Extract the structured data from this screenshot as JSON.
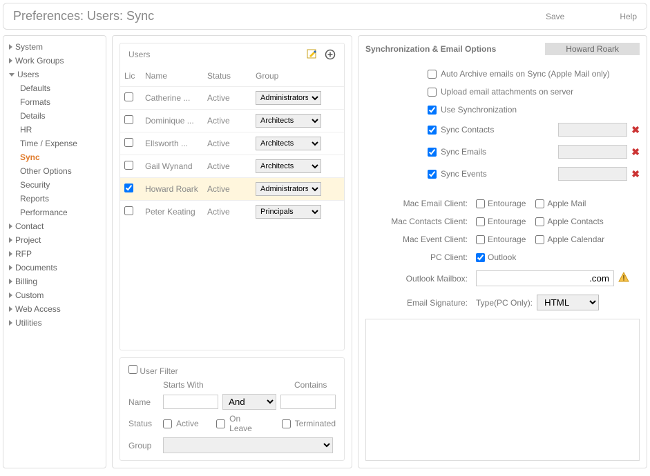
{
  "header": {
    "title": "Preferences: Users: Sync",
    "save": "Save",
    "help": "Help"
  },
  "sidebar": {
    "items": [
      {
        "label": "System",
        "expanded": false,
        "sub": []
      },
      {
        "label": "Work Groups",
        "expanded": false,
        "sub": []
      },
      {
        "label": "Users",
        "expanded": true,
        "sub": [
          {
            "label": "Defaults"
          },
          {
            "label": "Formats"
          },
          {
            "label": "Details"
          },
          {
            "label": "HR"
          },
          {
            "label": "Time / Expense"
          },
          {
            "label": "Sync",
            "active": true
          },
          {
            "label": "Other Options"
          },
          {
            "label": "Security"
          },
          {
            "label": "Reports"
          },
          {
            "label": "Performance"
          }
        ]
      },
      {
        "label": "Contact",
        "expanded": false,
        "sub": []
      },
      {
        "label": "Project",
        "expanded": false,
        "sub": []
      },
      {
        "label": "RFP",
        "expanded": false,
        "sub": []
      },
      {
        "label": "Documents",
        "expanded": false,
        "sub": []
      },
      {
        "label": "Billing",
        "expanded": false,
        "sub": []
      },
      {
        "label": "Custom",
        "expanded": false,
        "sub": []
      },
      {
        "label": "Web Access",
        "expanded": false,
        "sub": []
      },
      {
        "label": "Utilities",
        "expanded": false,
        "sub": []
      }
    ]
  },
  "users": {
    "title": "Users",
    "columns": {
      "lic": "Lic",
      "name": "Name",
      "status": "Status",
      "group": "Group"
    },
    "group_options": [
      "Administrators",
      "Architects",
      "Principals"
    ],
    "rows": [
      {
        "checked": false,
        "name": "Catherine ...",
        "status": "Active",
        "group": "Administrators"
      },
      {
        "checked": false,
        "name": "Dominique ...",
        "status": "Active",
        "group": "Architects"
      },
      {
        "checked": false,
        "name": "Ellsworth ...",
        "status": "Active",
        "group": "Architects"
      },
      {
        "checked": false,
        "name": "Gail Wynand",
        "status": "Active",
        "group": "Architects"
      },
      {
        "checked": true,
        "name": "Howard Roark",
        "status": "Active",
        "group": "Administrators",
        "selected": true
      },
      {
        "checked": false,
        "name": "Peter Keating",
        "status": "Active",
        "group": "Principals"
      }
    ]
  },
  "filter": {
    "title": "User Filter",
    "starts_with": "Starts With",
    "contains": "Contains",
    "name": "Name",
    "and": "And",
    "status": "Status",
    "active": "Active",
    "on_leave": "On Leave",
    "terminated": "Terminated",
    "group": "Group"
  },
  "sync": {
    "title": "Synchronization & Email Options",
    "user": "Howard Roark",
    "opts": {
      "auto_archive": {
        "label": "Auto Archive emails on Sync (Apple Mail only)",
        "checked": false
      },
      "upload_attach": {
        "label": "Upload email attachments on server",
        "checked": false
      },
      "use_sync": {
        "label": "Use Synchronization",
        "checked": true
      },
      "sync_contacts": {
        "label": "Sync Contacts",
        "checked": true,
        "hasBox": true
      },
      "sync_emails": {
        "label": "Sync Emails",
        "checked": true,
        "hasBox": true
      },
      "sync_events": {
        "label": "Sync Events",
        "checked": true,
        "hasBox": true
      }
    },
    "clients": {
      "mac_email": {
        "label": "Mac Email Client:",
        "opts": [
          "Entourage",
          "Apple Mail"
        ]
      },
      "mac_contacts": {
        "label": "Mac Contacts Client:",
        "opts": [
          "Entourage",
          "Apple Contacts"
        ]
      },
      "mac_event": {
        "label": "Mac Event Client:",
        "opts": [
          "Entourage",
          "Apple Calendar"
        ]
      },
      "pc_client": {
        "label": "PC Client:",
        "opts": [
          "Outlook"
        ],
        "checked": [
          true
        ]
      }
    },
    "mailbox": {
      "label": "Outlook Mailbox:",
      "value": ".com"
    },
    "signature": {
      "label": "Email Signature:",
      "type_label": "Type(PC Only):",
      "type_value": "HTML"
    }
  }
}
